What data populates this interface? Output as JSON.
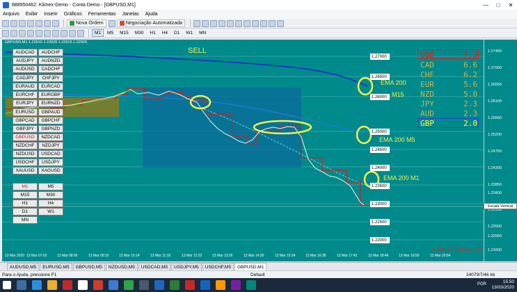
{
  "window": {
    "title": "888950462: Klimex-Demo - Conta Demo - [GBPUSD,M1]",
    "controls": [
      "minimize-icon",
      "restore-icon",
      "close-icon"
    ]
  },
  "menu": [
    "Arquivo",
    "Exibir",
    "Inserir",
    "Gráficos",
    "Ferramentas",
    "Janelas",
    "Ajuda"
  ],
  "toolbar": {
    "new_order": "Nova Ordem",
    "auto_trading": "Negociação Automatizada",
    "timeframes": [
      "M1",
      "M5",
      "M15",
      "M30",
      "H1",
      "H4",
      "D1",
      "W1",
      "MN"
    ],
    "selected_timeframe": "M1"
  },
  "chart": {
    "header": "GBPUSD,M1  1.22915 1.22928 1.22915 1.22926",
    "price_ticks": [
      "1.27450",
      "1.27000",
      "1.26550",
      "1.26100",
      "1.25650",
      "1.25200",
      "1.24750",
      "1.24300",
      "1.23850",
      "1.23400",
      "1.22950",
      "1.22500",
      "1.22050",
      "1.21600"
    ],
    "price_tags": [
      "1.27000",
      "1.26500",
      "1.26000",
      "1.25000",
      "1.24500",
      "1.24000",
      "1.23500",
      "1.23000",
      "1.22500",
      "1.22000"
    ],
    "time_ticks": [
      "13 Mar 2020",
      "13 Mar 07:02",
      "13 Mar 08:06",
      "13 Mar 09:10",
      "13 Mar 10:14",
      "13 Mar 11:18",
      "13 Mar 12:22",
      "13 Mar 13:26",
      "13 Mar 14:30",
      "13 Mar 15:34",
      "13 Mar 16:38",
      "13 Mar 17:42",
      "13 Mar 18:46",
      "13 Mar 19:50",
      "13 Mar 20:54"
    ],
    "sell_label": "SELL",
    "ema_labels": [
      "EMA 200",
      "M15",
      "EMA 200 M5",
      "EMA 200 M1"
    ],
    "scale_label": "Escala Vertical",
    "bottom_note": "Sz: 18 Posit: 1 13:11 Lotes: 1.01"
  },
  "symbols": {
    "pairs": [
      [
        "AUDCAD",
        "AUDCHF"
      ],
      [
        "AUDJPY",
        "AUDNZD"
      ],
      [
        "AUDUSD",
        "CADCHF"
      ],
      [
        "CADJPY",
        "CHFJPY"
      ],
      [
        "EURAUD",
        "EURCAD"
      ],
      [
        "EURCHF",
        "EURGBP"
      ],
      [
        "EURJPY",
        "EURNZD"
      ],
      [
        "EURUSD",
        "GBPAUD"
      ],
      [
        "GBPCAD",
        "GBPCHF"
      ],
      [
        "GBPJPY",
        "GBPNZD"
      ],
      [
        "GBPUSD",
        "NZDCAD"
      ],
      [
        "NZDCHF",
        "NZDJPY"
      ],
      [
        "NZDUSD",
        "USDCAD"
      ],
      [
        "USDCHF",
        "USDJPY"
      ],
      [
        "XAUUSD",
        "XAGUSD"
      ]
    ],
    "active": "GBPUSD",
    "timeframes": [
      [
        "M1",
        "M5"
      ],
      [
        "M15",
        "M30"
      ],
      [
        "H1",
        "H4"
      ],
      [
        "D1",
        "W1"
      ],
      [
        "MN"
      ]
    ],
    "active_timeframe": "M1"
  },
  "strength": [
    {
      "currency": "USD",
      "value": "7.3"
    },
    {
      "currency": "CAD",
      "value": "6.6"
    },
    {
      "currency": "CHF",
      "value": "6.2"
    },
    {
      "currency": "EUR",
      "value": "5.6"
    },
    {
      "currency": "NZD",
      "value": "5.0"
    },
    {
      "currency": "JPY",
      "value": "2.3"
    },
    {
      "currency": "AUD",
      "value": "2.3"
    },
    {
      "currency": "GBP",
      "value": "2.0"
    }
  ],
  "tabs": [
    "AUDUSD,M5",
    "EURUSD,M5",
    "GBPUSD,M5",
    "NZDUSD,M5",
    "USDCAD,M5",
    "USDJPY,M5",
    "USDCHF,M5",
    "GBPUSD,M1"
  ],
  "selected_tab": "GBPUSD,M1",
  "status": {
    "help": "Para o Ajuda, pressione F1",
    "profile": "Default",
    "traffic": "24079/7/46 kb"
  },
  "taskbar": {
    "time": "15:50",
    "date": "13/03/2020",
    "lang": "POR"
  },
  "colors": {
    "chart_bg": "#008a8c",
    "ema_m15": "#1c28c8",
    "ema_m5": "#1c7bd6",
    "highlight": "#f2f24a"
  }
}
